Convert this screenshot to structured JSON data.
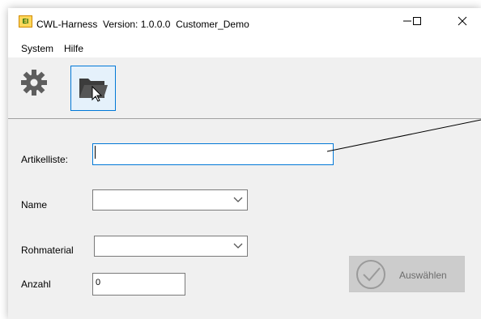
{
  "window": {
    "app_icon_text": "El",
    "title": "CWL-Harness  Version: 1.0.0.0  Customer_Demo",
    "controls": [
      "minimize-icon",
      "maximize-icon",
      "close-icon"
    ]
  },
  "menu": {
    "items": [
      {
        "label": "System"
      },
      {
        "label": "Hilfe"
      }
    ]
  },
  "toolbar": {
    "buttons": [
      {
        "icon": "gear-icon"
      },
      {
        "icon": "folder-icon"
      }
    ]
  },
  "form": {
    "artikelliste": {
      "label": "Artikelliste:",
      "value": ""
    },
    "name": {
      "label": "Name",
      "value": ""
    },
    "rohmaterial": {
      "label": "Rohmaterial",
      "value": ""
    },
    "anzahl": {
      "label": "Anzahl",
      "value": "0"
    }
  },
  "select_button": {
    "label": "Auswählen",
    "icon": "check-circle-icon",
    "enabled": false
  },
  "colors": {
    "focus": "#0078d7",
    "background": "#f0f0f0",
    "disabled_button": "#cccccc"
  }
}
